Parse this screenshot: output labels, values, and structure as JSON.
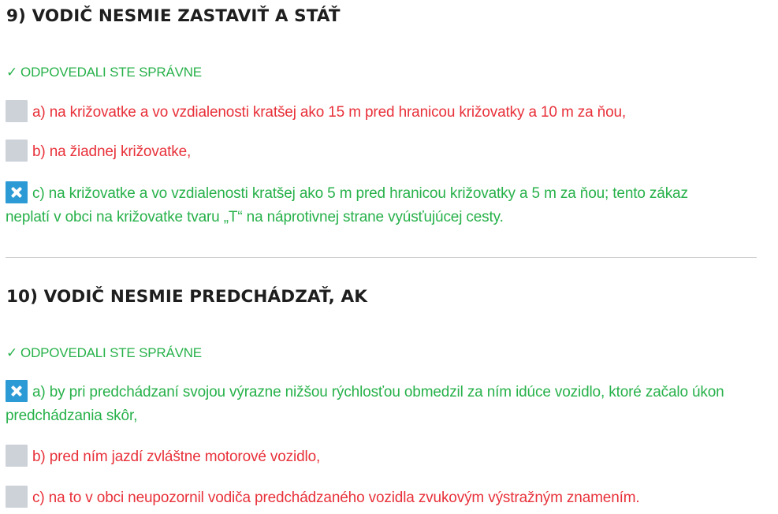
{
  "questions": [
    {
      "title": "9) VODIČ NESMIE ZASTAVIŤ A STÁŤ",
      "status": "ODPOVEDALI STE SPRÁVNE",
      "status_icon": "check-icon",
      "answers": [
        {
          "text": "a) na križovatke a vo vzdialenosti kratšej ako 15 m pred hranicou križovatky a 10 m za ňou,",
          "checked": false,
          "correct": false
        },
        {
          "text": "b) na žiadnej križovatke,",
          "checked": false,
          "correct": false
        },
        {
          "text": "c) na križovatke a vo vzdialenosti kratšej ako 5 m pred hranicou križovatky a 5 m za ňou; tento zákaz neplatí v obci na križovatke tvaru „T“ na náprotivnej strane vyúsťujúcej cesty.",
          "checked": true,
          "correct": true
        }
      ]
    },
    {
      "title": "10) VODIČ NESMIE PREDCHÁDZAŤ, AK",
      "status": "ODPOVEDALI STE SPRÁVNE",
      "status_icon": "check-icon",
      "answers": [
        {
          "text": "a) by pri predchádzaní svojou výrazne nižšou rýchlosťou obmedzil za ním idúce vozidlo, ktoré začalo úkon predchádzania skôr,",
          "checked": true,
          "correct": true
        },
        {
          "text": "b) pred ním jazdí zvláštne motorové vozidlo,",
          "checked": false,
          "correct": false
        },
        {
          "text": "c) na to v obci neupozornil vodiča predchádzaného vozidla zvukovým výstražným znamením.",
          "checked": false,
          "correct": false
        }
      ]
    }
  ],
  "colors": {
    "correct": "#27b14a",
    "wrong": "#e8313a",
    "checkbox_checked": "#2c9ad4",
    "checkbox_empty": "#cdd1d8",
    "title": "#1e1e1e"
  }
}
